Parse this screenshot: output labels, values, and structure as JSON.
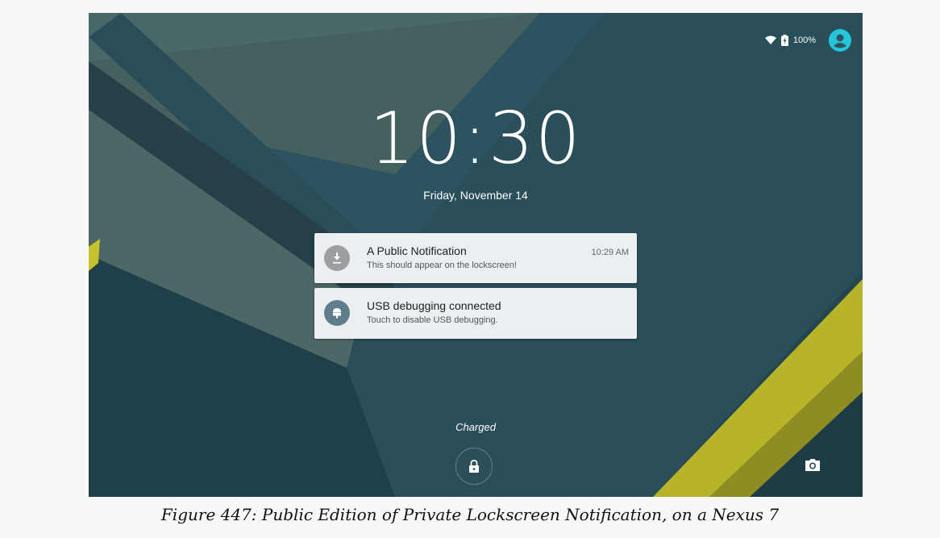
{
  "status_bar": {
    "battery_percent": "100%",
    "wifi_icon": "wifi-icon",
    "battery_icon": "battery-charging-icon",
    "user_icon": "user-avatar-icon"
  },
  "lockscreen": {
    "time": "10:30",
    "date": "Friday, November 14",
    "charging_status": "Charged",
    "lock_icon": "lock-icon",
    "camera_icon": "camera-icon"
  },
  "notifications": [
    {
      "title": "A Public Notification",
      "text": "This should appear on the lockscreen!",
      "time": "10:29 AM",
      "icon": "download-icon",
      "icon_color": "#9e9e9e"
    },
    {
      "title": "USB debugging connected",
      "text": "Touch to disable USB debugging.",
      "time": "",
      "icon": "android-icon",
      "icon_color": "#607d8b"
    }
  ],
  "caption": "Figure 447: Public Edition of Private Lockscreen Notification, on a Nexus 7",
  "colors": {
    "accent": "#26c6da",
    "wallpaper_dark": "#244650",
    "wallpaper_mid": "#2f5561",
    "stripe_yellow": "#c6c22b"
  }
}
